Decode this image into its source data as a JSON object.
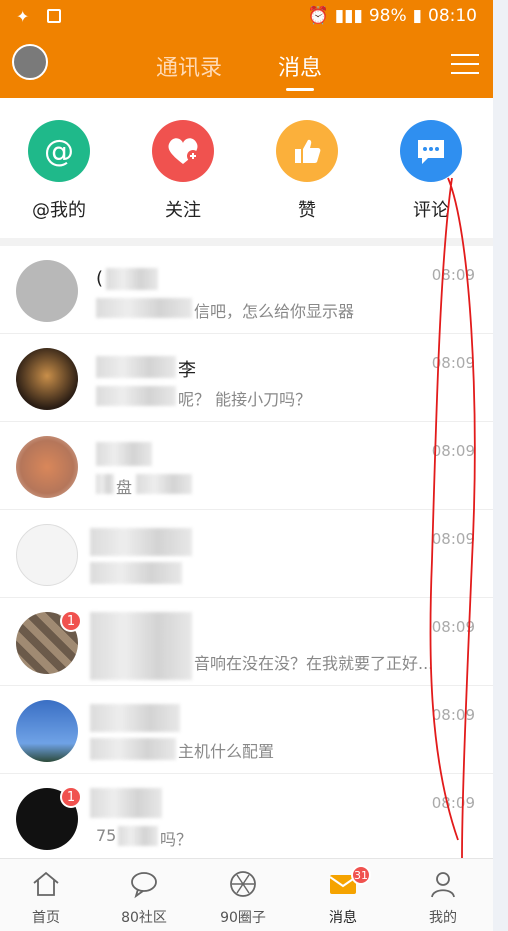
{
  "status": {
    "battery": "98%",
    "time": "08:10"
  },
  "header": {
    "tab_contacts": "通讯录",
    "tab_messages": "消息"
  },
  "quick_actions": [
    {
      "label": "@我的",
      "icon": "at-icon",
      "color": "#1fb98a"
    },
    {
      "label": "关注",
      "icon": "heart-plus-icon",
      "color": "#f0524f"
    },
    {
      "label": "赞",
      "icon": "thumbs-up-icon",
      "color": "#fbb03b"
    },
    {
      "label": "评论",
      "icon": "chat-bubble-icon",
      "color": "#2f8ff0"
    }
  ],
  "conversations": [
    {
      "name": "(",
      "message": "信吧，怎么给你显示器",
      "time": "08:09",
      "badge": ""
    },
    {
      "name": "李",
      "message": "呢？ 能接小刀吗？",
      "time": "08:09",
      "badge": ""
    },
    {
      "name": "",
      "message": "盘",
      "time": "08:09",
      "badge": ""
    },
    {
      "name": "",
      "message": "",
      "time": "08:09",
      "badge": ""
    },
    {
      "name": "",
      "message": "音响在没在没？在我就要了正好...",
      "time": "08:09",
      "badge": "1"
    },
    {
      "name": "",
      "message": "主机什么配置",
      "time": "08:09",
      "badge": ""
    },
    {
      "name": "",
      "message": "吗？",
      "message_prefix": "75",
      "time": "08:09",
      "badge": "1"
    }
  ],
  "bottom_nav": [
    {
      "label": "首页",
      "icon": "home-icon"
    },
    {
      "label": "80社区",
      "icon": "chat-icon"
    },
    {
      "label": "90圈子",
      "icon": "aperture-icon"
    },
    {
      "label": "消息",
      "icon": "mail-icon",
      "badge": "31"
    },
    {
      "label": "我的",
      "icon": "person-icon"
    }
  ],
  "colors": {
    "accent": "#f08200"
  }
}
